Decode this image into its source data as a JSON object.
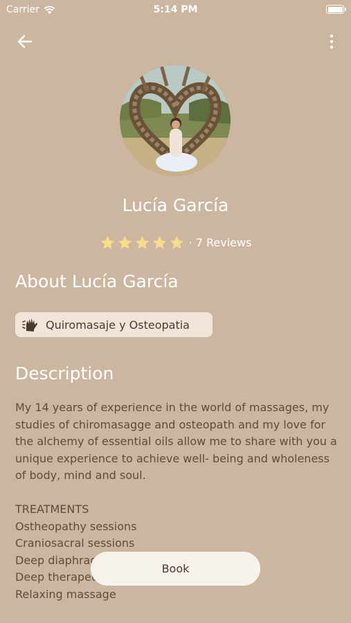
{
  "status_bar": {
    "carrier": "Carrier",
    "time": "5:14 PM"
  },
  "profile": {
    "name": "Lucía García",
    "rating_stars": 5,
    "reviews_label": "7 Reviews"
  },
  "about": {
    "title": "About Lucía García",
    "specialty": "Quiromasaje y Osteopatia"
  },
  "description": {
    "title": "Description",
    "text": "My 14 years of experience in the world of massages, my studies of chiromasagge and osteopath and my love for the alchemy of essential oils allow me to share with you a unique experience to achieve well- being and wholeness of body, mind and soul.\n\nTREATMENTS\nOstheopathy sessions\nCraniosacral sessions\nDeep diaphragm\nDeep therapeutic\nRelaxing massage"
  },
  "book_button": {
    "label": "Book"
  },
  "colors": {
    "background": "#cdb6a0",
    "chip": "#f1e5d9",
    "star": "#f6dd8a",
    "text_body": "#5d4c3e",
    "button": "#f8f2ed"
  },
  "icons": [
    "wifi-icon",
    "battery-icon",
    "back-arrow-icon",
    "more-vertical-icon",
    "star-icon",
    "massage-hand-icon"
  ]
}
